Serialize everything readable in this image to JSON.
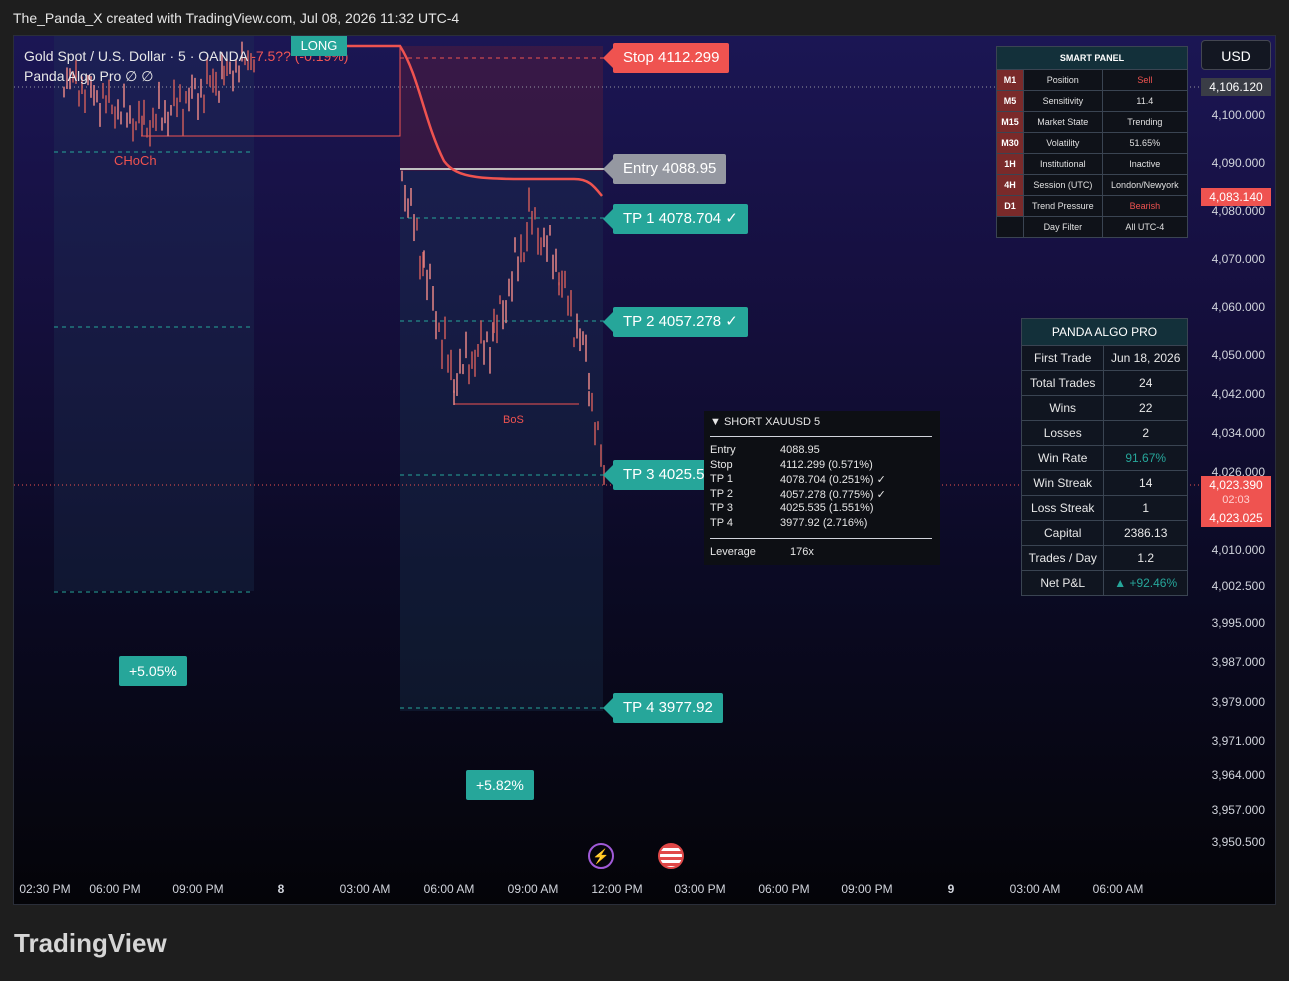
{
  "header": "The_Panda_X created with TradingView.com, Jul 08, 2026 11:32 UTC-4",
  "symbol": {
    "line1": "Gold Spot / U.S. Dollar · 5 · OANDA",
    "change": "-7.5?? (-0.19%)",
    "line2": "Panda Algo Pro  ∅  ∅"
  },
  "long_label": "LONG",
  "currency": "USD",
  "levels": {
    "stop": "Stop  4112.299",
    "entry": "Entry  4088.95",
    "tp1": "TP 1  4078.704  ✓",
    "tp2": "TP 2  4057.278  ✓",
    "tp3": "TP 3  4025.5",
    "tp4": "TP 4  3977.92"
  },
  "annotations": {
    "choch": "CHoCh",
    "bos": "BoS",
    "gain1": "+5.05%",
    "gain2": "+5.82%"
  },
  "chart_data": {
    "type": "candlestick",
    "y_ticks": [
      "4,100.000",
      "4,090.000",
      "4,080.000",
      "4,070.000",
      "4,060.000",
      "4,050.000",
      "4,042.000",
      "4,034.000",
      "4,026.000",
      "4,010.000",
      "4,002.500",
      "3,995.000",
      "3,987.000",
      "3,979.000",
      "3,971.000",
      "3,964.000",
      "3,957.000",
      "3,950.500"
    ],
    "x_ticks": [
      "02:30 PM",
      "06:00 PM",
      "09:00 PM",
      "8",
      "03:00 AM",
      "06:00 AM",
      "09:00 AM",
      "12:00 PM",
      "03:00 PM",
      "06:00 PM",
      "09:00 PM",
      "9",
      "03:00 AM",
      "06:00 AM"
    ],
    "price_labels": {
      "top": "4,106.120",
      "mid": "4,083.140",
      "last": "4,023.390",
      "countdown": "02:03",
      "low": "4,023.025"
    },
    "close_path_est": [
      4096,
      4100,
      4110,
      4105,
      4108,
      4098,
      4085,
      4080,
      4065,
      4052,
      4045,
      4050,
      4040,
      4062,
      4072,
      4078,
      4070,
      4060,
      4045,
      4035,
      4024
    ]
  },
  "smart_panel": {
    "title": "SMART PANEL",
    "rows": [
      {
        "tf": "M1",
        "k": "Position",
        "v": "Sell"
      },
      {
        "tf": "M5",
        "k": "Sensitivity",
        "v": "11.4"
      },
      {
        "tf": "M15",
        "k": "Market State",
        "v": "Trending"
      },
      {
        "tf": "M30",
        "k": "Volatility",
        "v": "51.65%"
      },
      {
        "tf": "1H",
        "k": "Institutional",
        "v": "Inactive"
      },
      {
        "tf": "4H",
        "k": "Session (UTC)",
        "v": "London/Newyork"
      },
      {
        "tf": "D1",
        "k": "Trend Pressure",
        "v": "Bearish"
      },
      {
        "tf": "",
        "k": "Day Filter",
        "v": "All  UTC-4"
      }
    ]
  },
  "algo_panel": {
    "title": "PANDA  ALGO  PRO",
    "rows": [
      {
        "k": "First Trade",
        "v": "Jun 18, 2026"
      },
      {
        "k": "Total Trades",
        "v": "24"
      },
      {
        "k": "Wins",
        "v": "22"
      },
      {
        "k": "Losses",
        "v": "2"
      },
      {
        "k": "Win Rate",
        "v": "91.67%"
      },
      {
        "k": "Win Streak",
        "v": "14"
      },
      {
        "k": "Loss Streak",
        "v": "1"
      },
      {
        "k": "Capital",
        "v": "2386.13"
      },
      {
        "k": "Trades / Day",
        "v": "1.2"
      },
      {
        "k": "Net P&L",
        "v": "▲ +92.46%"
      }
    ]
  },
  "trade_box": {
    "title": "▼  SHORT     XAUUSD    5",
    "rows": [
      {
        "k": "Entry",
        "v": "4088.95"
      },
      {
        "k": "Stop",
        "v": "4112.299  (0.571%)"
      },
      {
        "k": "TP 1",
        "v": "4078.704  (0.251%)  ✓"
      },
      {
        "k": "TP 2",
        "v": "4057.278  (0.775%)  ✓"
      },
      {
        "k": "TP 3",
        "v": "4025.535  (1.551%)"
      },
      {
        "k": "TP 4",
        "v": "3977.92   (2.716%)"
      }
    ],
    "leverage_k": "Leverage",
    "leverage_v": "176x"
  },
  "brand": "TradingView",
  "colors": {
    "bear": "#ef5350",
    "bull": "#26a69a",
    "entry": "#9598a1"
  }
}
